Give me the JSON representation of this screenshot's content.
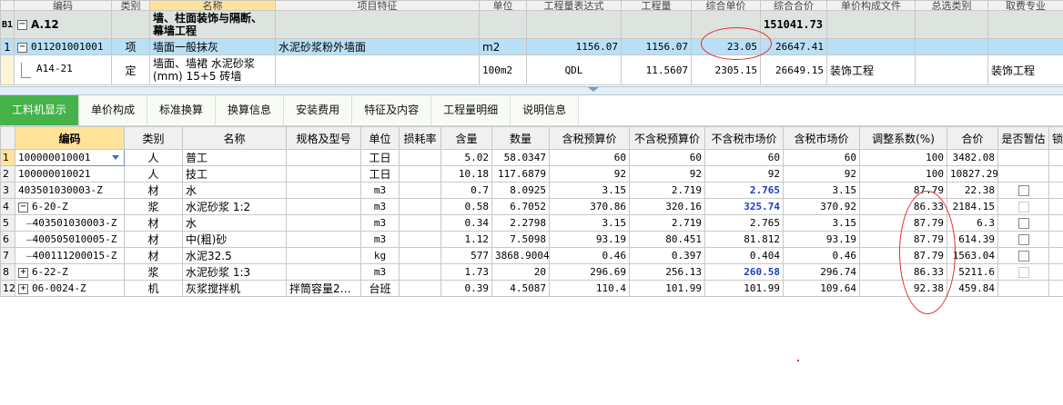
{
  "top_grid": {
    "header": [
      "编码",
      "类别",
      "名称",
      "项目特征",
      "单位",
      "工程量表达式",
      "工程量",
      "综合单价",
      "综合合价",
      "单价构成文件",
      "总选类别",
      "取费专业"
    ],
    "section": {
      "id": "B1",
      "code": "A.12",
      "name": "墙、柱面装饰与隔断、幕墙工程",
      "total": "151041.73"
    },
    "rows": [
      {
        "num": "1",
        "code": "011201001001",
        "type": "项",
        "name": "墙面一般抹灰",
        "feature": "水泥砂浆粉外墙面",
        "unit": "m2",
        "expr": "1156.07",
        "qty": "1156.07",
        "unit_price": "23.05",
        "total": "26647.41",
        "price_file": "",
        "category": ""
      },
      {
        "num": "",
        "code": "A14-21",
        "type": "定",
        "name": "墙面、墙裙 水泥砂浆(mm) 15+5 砖墙",
        "feature": "",
        "unit": "100m2",
        "expr": "QDL",
        "qty": "11.5607",
        "unit_price": "2305.15",
        "total": "26649.15",
        "price_file": "装饰工程",
        "category": "装饰工程"
      }
    ]
  },
  "tabs": [
    "工料机显示",
    "单价构成",
    "标准换算",
    "换算信息",
    "安装费用",
    "特征及内容",
    "工程量明细",
    "说明信息"
  ],
  "bottom_grid": {
    "header": [
      "编码",
      "类别",
      "名称",
      "规格及型号",
      "单位",
      "损耗率",
      "含量",
      "数量",
      "含税预算价",
      "不含税预算价",
      "不含税市场价",
      "含税市场价",
      "调整系数(%)",
      "合价",
      "是否暂估",
      "锁"
    ],
    "rows": [
      {
        "num": "1",
        "code": "100000010001",
        "type": "人",
        "name": "普工",
        "spec": "",
        "unit": "工日",
        "loss": "",
        "content": "5.02",
        "qty": "58.0347",
        "tax_budget": "60",
        "notax_budget": "60",
        "notax_market": "60",
        "tax_market": "60",
        "coef": "100",
        "total": "3482.08"
      },
      {
        "num": "2",
        "code": "100000010021",
        "type": "人",
        "name": "技工",
        "spec": "",
        "unit": "工日",
        "loss": "",
        "content": "10.18",
        "qty": "117.6879",
        "tax_budget": "92",
        "notax_budget": "92",
        "notax_market": "92",
        "tax_market": "92",
        "coef": "100",
        "total": "10827.29"
      },
      {
        "num": "3",
        "code": "403501030003-Z",
        "type": "材",
        "name": "水",
        "spec": "",
        "unit": "m3",
        "loss": "",
        "content": "0.7",
        "qty": "8.0925",
        "tax_budget": "3.15",
        "notax_budget": "2.719",
        "notax_market": "2.765",
        "tax_market": "3.15",
        "coef": "87.79",
        "total": "22.38"
      },
      {
        "num": "4",
        "code": "6-20-Z",
        "type": "浆",
        "name": "水泥砂浆 1:2",
        "spec": "",
        "unit": "m3",
        "loss": "",
        "content": "0.58",
        "qty": "6.7052",
        "tax_budget": "370.86",
        "notax_budget": "320.16",
        "notax_market": "325.74",
        "tax_market": "370.92",
        "coef": "86.33",
        "total": "2184.15"
      },
      {
        "num": "5",
        "code": "403501030003-Z",
        "type": "材",
        "name": "水",
        "spec": "",
        "unit": "m3",
        "loss": "",
        "content": "0.34",
        "qty": "2.2798",
        "tax_budget": "3.15",
        "notax_budget": "2.719",
        "notax_market": "2.765",
        "tax_market": "3.15",
        "coef": "87.79",
        "total": "6.3"
      },
      {
        "num": "6",
        "code": "400505010005-Z",
        "type": "材",
        "name": "中(粗)砂",
        "spec": "",
        "unit": "m3",
        "loss": "",
        "content": "1.12",
        "qty": "7.5098",
        "tax_budget": "93.19",
        "notax_budget": "80.451",
        "notax_market": "81.812",
        "tax_market": "93.19",
        "coef": "87.79",
        "total": "614.39"
      },
      {
        "num": "7",
        "code": "400111200015-Z",
        "type": "材",
        "name": "水泥32.5",
        "spec": "",
        "unit": "kg",
        "loss": "",
        "content": "577",
        "qty": "3868.9004",
        "tax_budget": "0.46",
        "notax_budget": "0.397",
        "notax_market": "0.404",
        "tax_market": "0.46",
        "coef": "87.79",
        "total": "1563.04"
      },
      {
        "num": "8",
        "code": "6-22-Z",
        "type": "浆",
        "name": "水泥砂浆 1:3",
        "spec": "",
        "unit": "m3",
        "loss": "",
        "content": "1.73",
        "qty": "20",
        "tax_budget": "296.69",
        "notax_budget": "256.13",
        "notax_market": "260.58",
        "tax_market": "296.74",
        "coef": "86.33",
        "total": "5211.6"
      },
      {
        "num": "12",
        "code": "06-0024-Z",
        "type": "机",
        "name": "灰浆搅拌机",
        "spec": "拌筒容量2…",
        "unit": "台班",
        "loss": "",
        "content": "0.39",
        "qty": "4.5087",
        "tax_budget": "110.4",
        "notax_budget": "101.99",
        "notax_market": "101.99",
        "tax_market": "109.64",
        "coef": "92.38",
        "total": "459.84"
      }
    ]
  },
  "colors": {
    "tab_active": "#45b24a",
    "selected_row": "#b9e0f6",
    "header_selected": "#ffe39a",
    "section_row": "#dde3de",
    "blue_value": "#1a3ec9",
    "annotation": "#e0302a"
  }
}
